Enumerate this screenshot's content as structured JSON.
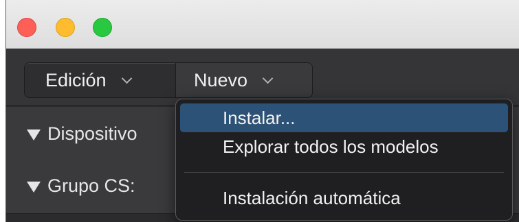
{
  "window": {
    "traffic_lights": [
      {
        "name": "close",
        "color": "#fe5f57"
      },
      {
        "name": "minimize",
        "color": "#febc2e"
      },
      {
        "name": "zoom",
        "color": "#28c840"
      }
    ]
  },
  "toolbar": {
    "segments": [
      {
        "label": "Edición",
        "icon": "chevron-down-icon"
      },
      {
        "label": "Nuevo",
        "icon": "chevron-down-icon"
      }
    ]
  },
  "list": {
    "rows": [
      {
        "label": "Dispositivo",
        "icon": "disclosure-triangle-icon"
      },
      {
        "label": "Grupo CS:",
        "icon": "disclosure-triangle-icon"
      }
    ]
  },
  "menu": {
    "items": [
      {
        "label": "Instalar...",
        "selected": true
      },
      {
        "label": "Explorar todos los modelos",
        "selected": false
      },
      {
        "label": "Instalación automática",
        "selected": false
      }
    ],
    "highlight_color": "#2d5277"
  }
}
